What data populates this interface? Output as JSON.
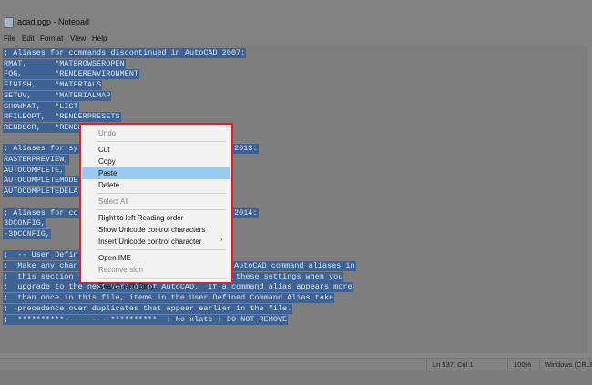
{
  "window": {
    "title": "acad.pgp - Notepad",
    "menu": [
      "File",
      "Edit",
      "Format",
      "View",
      "Help"
    ]
  },
  "editor": {
    "lines": [
      "; Aliases for commands discontinued in AutoCAD 2007:",
      "RMAT,      *MATBROWSEROPEN",
      "FOG,       *RENDERENVIRONMENT",
      "FINISH,    *MATERIALS",
      "SETUV,     *MATERIALMAP",
      "SHOWMAT,   *LIST",
      "RFILEOPT,  *RENDERPRESETS",
      "RENDSCR,   *RENDERWINDOW",
      "",
      "; Aliases for sy",
      "RASTERPREVIEW,",
      "AUTOCOMPLETE,",
      "AUTOCOMPLETEMODE",
      "AUTOCOMPLETEDELA",
      "",
      "; Aliases for co",
      "3DCONFIG,",
      "-3DCONFIG,",
      "",
      ";  -- User Defin",
      ";  Make any chan",
      ";  this section to ensure successful migration of these settings when you",
      ";  upgrade to the next version of AutoCAD.  If a command alias appears more",
      ";  than once in this file, items in the User Defined Command Alias take",
      ";  precedence over duplicates that appear earlier in the file.",
      ";  **********----------**********  ; No xlate ; DO NOT REMOVE"
    ],
    "line_tails": [
      {
        "line": 9,
        "text": "2013:"
      },
      {
        "line": 15,
        "text": "2014:"
      },
      {
        "line": 20,
        "text": "AutoCAD command aliases in"
      }
    ]
  },
  "context_menu": {
    "items": [
      {
        "label": "Undo",
        "enabled": false
      },
      {
        "separator": true
      },
      {
        "label": "Cut",
        "enabled": true
      },
      {
        "label": "Copy",
        "enabled": true
      },
      {
        "label": "Paste",
        "enabled": true,
        "highlighted": true
      },
      {
        "label": "Delete",
        "enabled": true
      },
      {
        "separator": true
      },
      {
        "label": "Select All",
        "enabled": false
      },
      {
        "separator": true
      },
      {
        "label": "Right to left Reading order",
        "enabled": true
      },
      {
        "label": "Show Unicode control characters",
        "enabled": true
      },
      {
        "label": "Insert Unicode control character",
        "enabled": true,
        "submenu_arrow": "›"
      },
      {
        "separator": true
      },
      {
        "label": "Open IME",
        "enabled": true
      },
      {
        "label": "Reconversion",
        "enabled": false
      },
      {
        "separator": true
      },
      {
        "label": "Search with Bing...",
        "enabled": true
      }
    ],
    "highlight_border_color": "#d7252c",
    "hover_color": "#99c9f0"
  },
  "statusbar": {
    "position": "Ln 537, Col 1",
    "zoom": "100%",
    "encoding": "Windows (CRLF"
  },
  "colors": {
    "selection_bg": "#3e6294",
    "selection_text": "#d9e4f2",
    "overlay_dim": "#7e7e7e"
  }
}
